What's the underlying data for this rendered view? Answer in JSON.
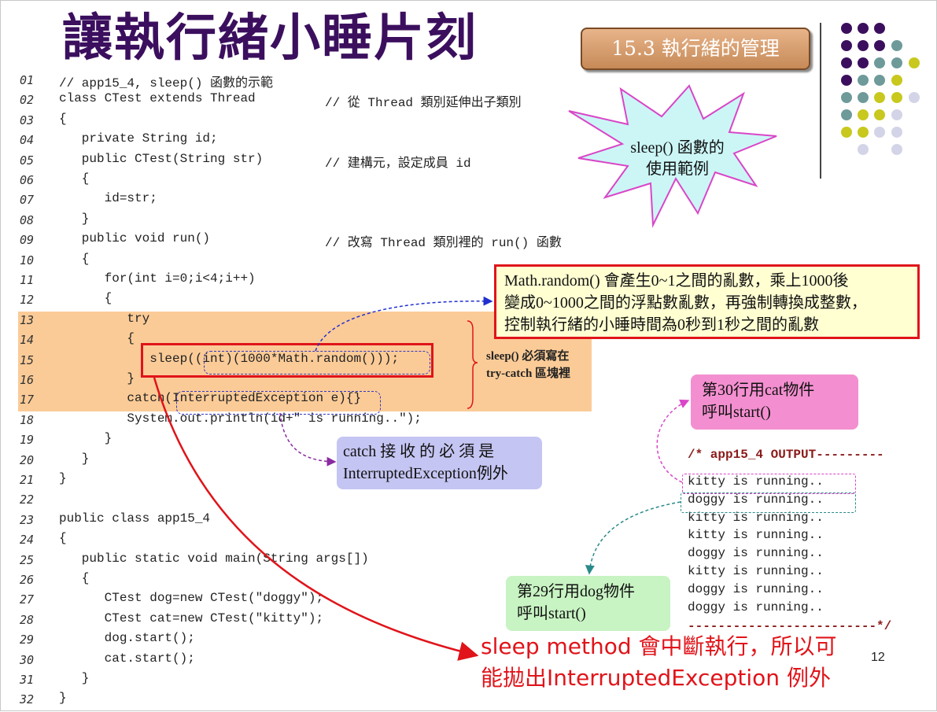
{
  "title": "讓執行緒小睡片刻",
  "section_badge": "15.3  執行緒的管理",
  "star_callout": {
    "line1": "sleep() 函數的",
    "line2": "使用範例"
  },
  "code_lines": [
    {
      "no": "01",
      "code": "// app15_4, sleep() 函數的示範",
      "comment": ""
    },
    {
      "no": "02",
      "code": "class CTest extends Thread",
      "comment": "// 從 Thread 類別延伸出子類別"
    },
    {
      "no": "03",
      "code": "{",
      "comment": ""
    },
    {
      "no": "04",
      "code": "   private String id;",
      "comment": ""
    },
    {
      "no": "05",
      "code": "   public CTest(String str)",
      "comment": "// 建構元，設定成員 id"
    },
    {
      "no": "06",
      "code": "   {",
      "comment": ""
    },
    {
      "no": "07",
      "code": "      id=str;",
      "comment": ""
    },
    {
      "no": "08",
      "code": "   }",
      "comment": ""
    },
    {
      "no": "09",
      "code": "   public void run()",
      "comment": "// 改寫 Thread 類別裡的 run() 函數"
    },
    {
      "no": "10",
      "code": "   {",
      "comment": ""
    },
    {
      "no": "11",
      "code": "      for(int i=0;i<4;i++)",
      "comment": ""
    },
    {
      "no": "12",
      "code": "      {",
      "comment": ""
    },
    {
      "no": "13",
      "code": "         try",
      "comment": ""
    },
    {
      "no": "14",
      "code": "         {",
      "comment": ""
    },
    {
      "no": "15",
      "code": "            sleep((int)(1000*Math.random()));",
      "comment": ""
    },
    {
      "no": "16",
      "code": "         }",
      "comment": ""
    },
    {
      "no": "17",
      "code": "         catch(InterruptedException e){}",
      "comment": ""
    },
    {
      "no": "18",
      "code": "         System.out.println(id+\" is running..\");",
      "comment": ""
    },
    {
      "no": "19",
      "code": "      }",
      "comment": ""
    },
    {
      "no": "20",
      "code": "   }",
      "comment": ""
    },
    {
      "no": "21",
      "code": "}",
      "comment": ""
    },
    {
      "no": "22",
      "code": "",
      "comment": ""
    },
    {
      "no": "23",
      "code": "public class app15_4",
      "comment": ""
    },
    {
      "no": "24",
      "code": "{",
      "comment": ""
    },
    {
      "no": "25",
      "code": "   public static void main(String args[])",
      "comment": ""
    },
    {
      "no": "26",
      "code": "   {",
      "comment": ""
    },
    {
      "no": "27",
      "code": "      CTest dog=new CTest(\"doggy\");",
      "comment": ""
    },
    {
      "no": "28",
      "code": "      CTest cat=new CTest(\"kitty\");",
      "comment": ""
    },
    {
      "no": "29",
      "code": "      dog.start();",
      "comment": ""
    },
    {
      "no": "30",
      "code": "      cat.start();",
      "comment": ""
    },
    {
      "no": "31",
      "code": "   }",
      "comment": ""
    },
    {
      "no": "32",
      "code": "}",
      "comment": ""
    }
  ],
  "math_note": {
    "line1": "Math.random() 會產生0~1之間的亂數，乘上1000後",
    "line2": "變成0~1000之間的浮點數亂數，再強制轉換成整數，",
    "line3": "控制執行緒的小睡時間為0秒到1秒之間的亂數"
  },
  "try_note": {
    "line1": "sleep() 必須寫在",
    "line2": "try-catch 區塊裡"
  },
  "catch_note": {
    "line1": "catch 接 收 的 必 須 是",
    "line2": "InterruptedException例外"
  },
  "cat_note": {
    "line1": "第30行用cat物件",
    "line2": "呼叫start()"
  },
  "dog_note": {
    "line1": "第29行用dog物件",
    "line2": "呼叫start()"
  },
  "output": {
    "header": "/* app15_4 OUTPUT---------",
    "lines": [
      "kitty is running..",
      "doggy is running..",
      "kitty is running..",
      "kitty is running..",
      "doggy is running..",
      "kitty is running..",
      "doggy is running..",
      "doggy is running.."
    ],
    "footer": "-------------------------*/"
  },
  "red_note": {
    "line1": "sleep method 會中斷執行，所以可",
    "line2": "能拋出InterruptedException 例外"
  },
  "page_number": "12",
  "colors": {
    "title": "#3b0f5e",
    "band": "#fbcb97",
    "red": "#e0141a",
    "dot_purple": "#3b0f5e",
    "dot_teal": "#6e9a9a",
    "dot_yellow": "#c8c81e",
    "dot_lilac": "#d4d4e8"
  }
}
